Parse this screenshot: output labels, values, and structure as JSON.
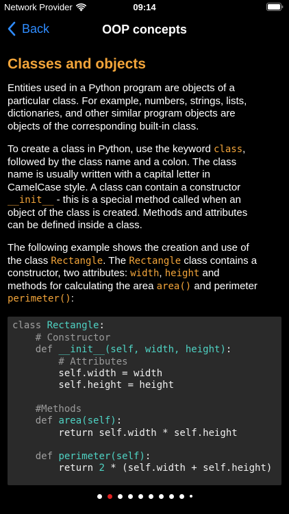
{
  "status": {
    "carrier": "Network Provider",
    "time": "09:14"
  },
  "nav": {
    "back_label": "Back",
    "title": "OOP concepts"
  },
  "section": {
    "title": "Classes and objects"
  },
  "paragraphs": {
    "p1": [
      "Entities used in a Python program are objects of a",
      "particular class. For example, numbers, strings, lists,",
      "dictionaries, and other similar program objects are",
      "objects of the corresponding built-in class."
    ],
    "p2": {
      "l1_text": "To create a class in Python, use the keyword ",
      "l1_kw": "class",
      "l1_end": ",",
      "l2": "followed by the class name and a colon. The class",
      "l3": "name is usually written with a capital letter in",
      "l4": "CamelCase style. A class can contain a constructor",
      "l5_kw": "__init__",
      "l5_text": " - this is a special method called when an",
      "l6": "object of the class is created. Methods and attributes",
      "l7": "can be defined inside a class."
    },
    "p3": {
      "l1": "The following example shows the creation and use of",
      "l2_a": "the class ",
      "l2_kw1": "Rectangle",
      "l2_b": ". The ",
      "l2_kw2": "Rectangle",
      "l2_c": " class contains a",
      "l3_a": "constructor, two attributes: ",
      "l3_kw1": "width",
      "l3_b": ", ",
      "l3_kw2": "height",
      "l3_c": " and",
      "l4_a": "methods for calculating the area ",
      "l4_kw": "area()",
      "l4_b": " and perimeter",
      "l5_kw": "perimeter()",
      "l5_b": ":"
    }
  },
  "code": {
    "l1_key": "class ",
    "l1_name": "Rectangle",
    "l1_end": ":",
    "l2": "    # Constructor",
    "l3_key": "    def ",
    "l3_name": "__init__(self, width, height)",
    "l3_end": ":",
    "l4": "        # Attributes",
    "l5": "        self.width = width",
    "l6": "        self.height = height",
    "l8": "    #Methods",
    "l9_key": "    def ",
    "l9_name": "area(self)",
    "l9_end": ":",
    "l10": "        return self.width * self.height",
    "l12_key": "    def ",
    "l12_name": "perimeter(self)",
    "l12_end": ":",
    "l13_a": "        return ",
    "l13_num": "2",
    "l13_b": " * (self.width + self.height)"
  },
  "colors": {
    "accent": "#f3a53a",
    "link": "#2f8cff",
    "code_name": "#4fd3c4",
    "page_indicator_active": "#e02020"
  }
}
